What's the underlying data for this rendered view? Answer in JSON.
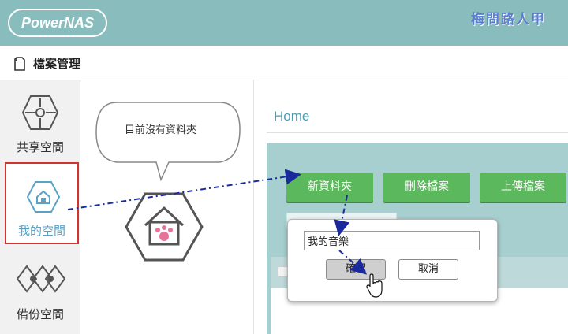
{
  "header": {
    "logo_text": "PowerNAS",
    "watermark": "梅問路人甲"
  },
  "titlebar": {
    "icon": "file-icon",
    "title": "檔案管理"
  },
  "sidebar": {
    "items": [
      {
        "label": "共享空間",
        "icon": "puzzle-icon",
        "active": false
      },
      {
        "label": "我的空間",
        "icon": "home-hexagon-icon",
        "active": true
      },
      {
        "label": "備份空間",
        "icon": "backup-hexagon-icon",
        "active": false
      }
    ]
  },
  "empty_state": {
    "message": "目前沒有資料夾",
    "icon": "house-paw-icon"
  },
  "main": {
    "breadcrumb": "Home",
    "toolbar": {
      "new_folder": "新資料夾",
      "delete_files": "刪除檔案",
      "upload_files": "上傳檔案"
    }
  },
  "dialog": {
    "input_value": "我的音樂",
    "ok_label": "確認",
    "cancel_label": "取消"
  },
  "colors": {
    "header_bg": "#89bcbd",
    "accent_green": "#5cb85c",
    "active_border": "#d0342c",
    "annotation_arrow": "#1a2a9c"
  }
}
